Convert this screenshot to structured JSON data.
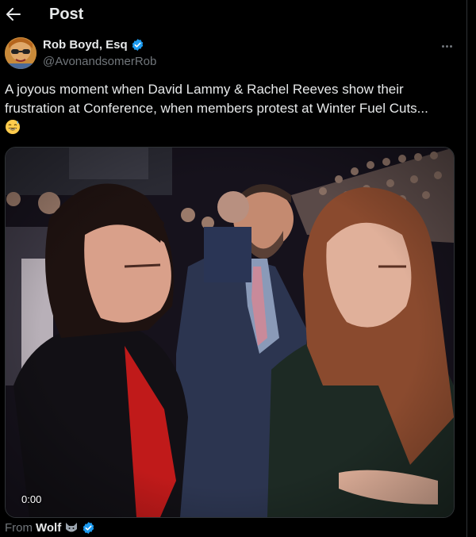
{
  "header": {
    "title": "Post",
    "back_icon": "arrow-left-icon"
  },
  "author": {
    "name": "Rob Boyd, Esq",
    "handle": "@AvonandsomerRob",
    "verified_icon": "verified-badge-icon",
    "verified_color": "#1d9bf0"
  },
  "post": {
    "text": "A joyous moment when David Lammy & Rachel Reeves show their frustration at Conference, when members protest at Winter Fuel Cuts...",
    "emoji_icon": "grinning-sweat-emoji-icon"
  },
  "media": {
    "timestamp": "0:00",
    "type": "video"
  },
  "via": {
    "prefix": "From",
    "source": "Wolf",
    "source_emoji": "wolf-emoji-icon"
  },
  "colors": {
    "background": "#000000",
    "text": "#e7e9ea",
    "secondary": "#71767b",
    "accent": "#1d9bf0"
  }
}
